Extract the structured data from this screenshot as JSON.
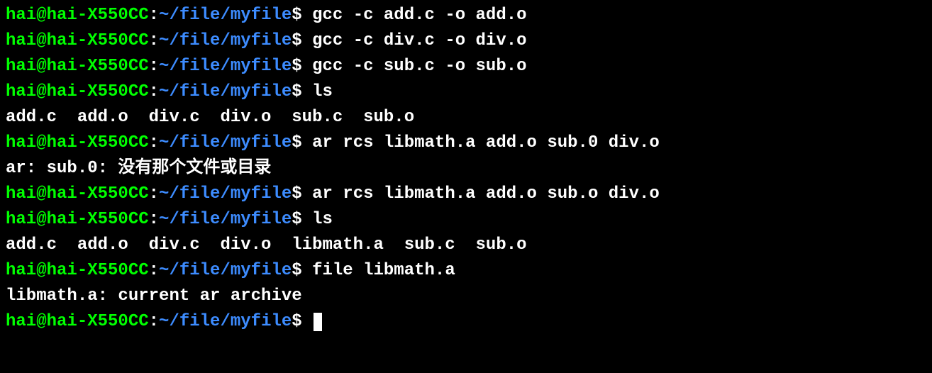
{
  "prompt": {
    "user": "hai@hai-X550CC",
    "colon": ":",
    "path": "~/file/myfile",
    "dollar": "$"
  },
  "lines": {
    "l1_cmd": " gcc -c add.c -o add.o",
    "l2_cmd": " gcc -c div.c -o div.o",
    "l3_cmd": " gcc -c sub.c -o sub.o",
    "l4_cmd": " ls",
    "l5_out": "add.c  add.o  div.c  div.o  sub.c  sub.o",
    "l6_cmd": " ar rcs libmath.a add.o sub.0 div.o",
    "l7_out": "ar: sub.0: 没有那个文件或目录",
    "l8_cmd": " ar rcs libmath.a add.o sub.o div.o",
    "l9_cmd": " ls",
    "l10_out": "add.c  add.o  div.c  div.o  libmath.a  sub.c  sub.o",
    "l11_cmd": " file libmath.a",
    "l12_out": "libmath.a: current ar archive",
    "l13_cmd": " "
  }
}
